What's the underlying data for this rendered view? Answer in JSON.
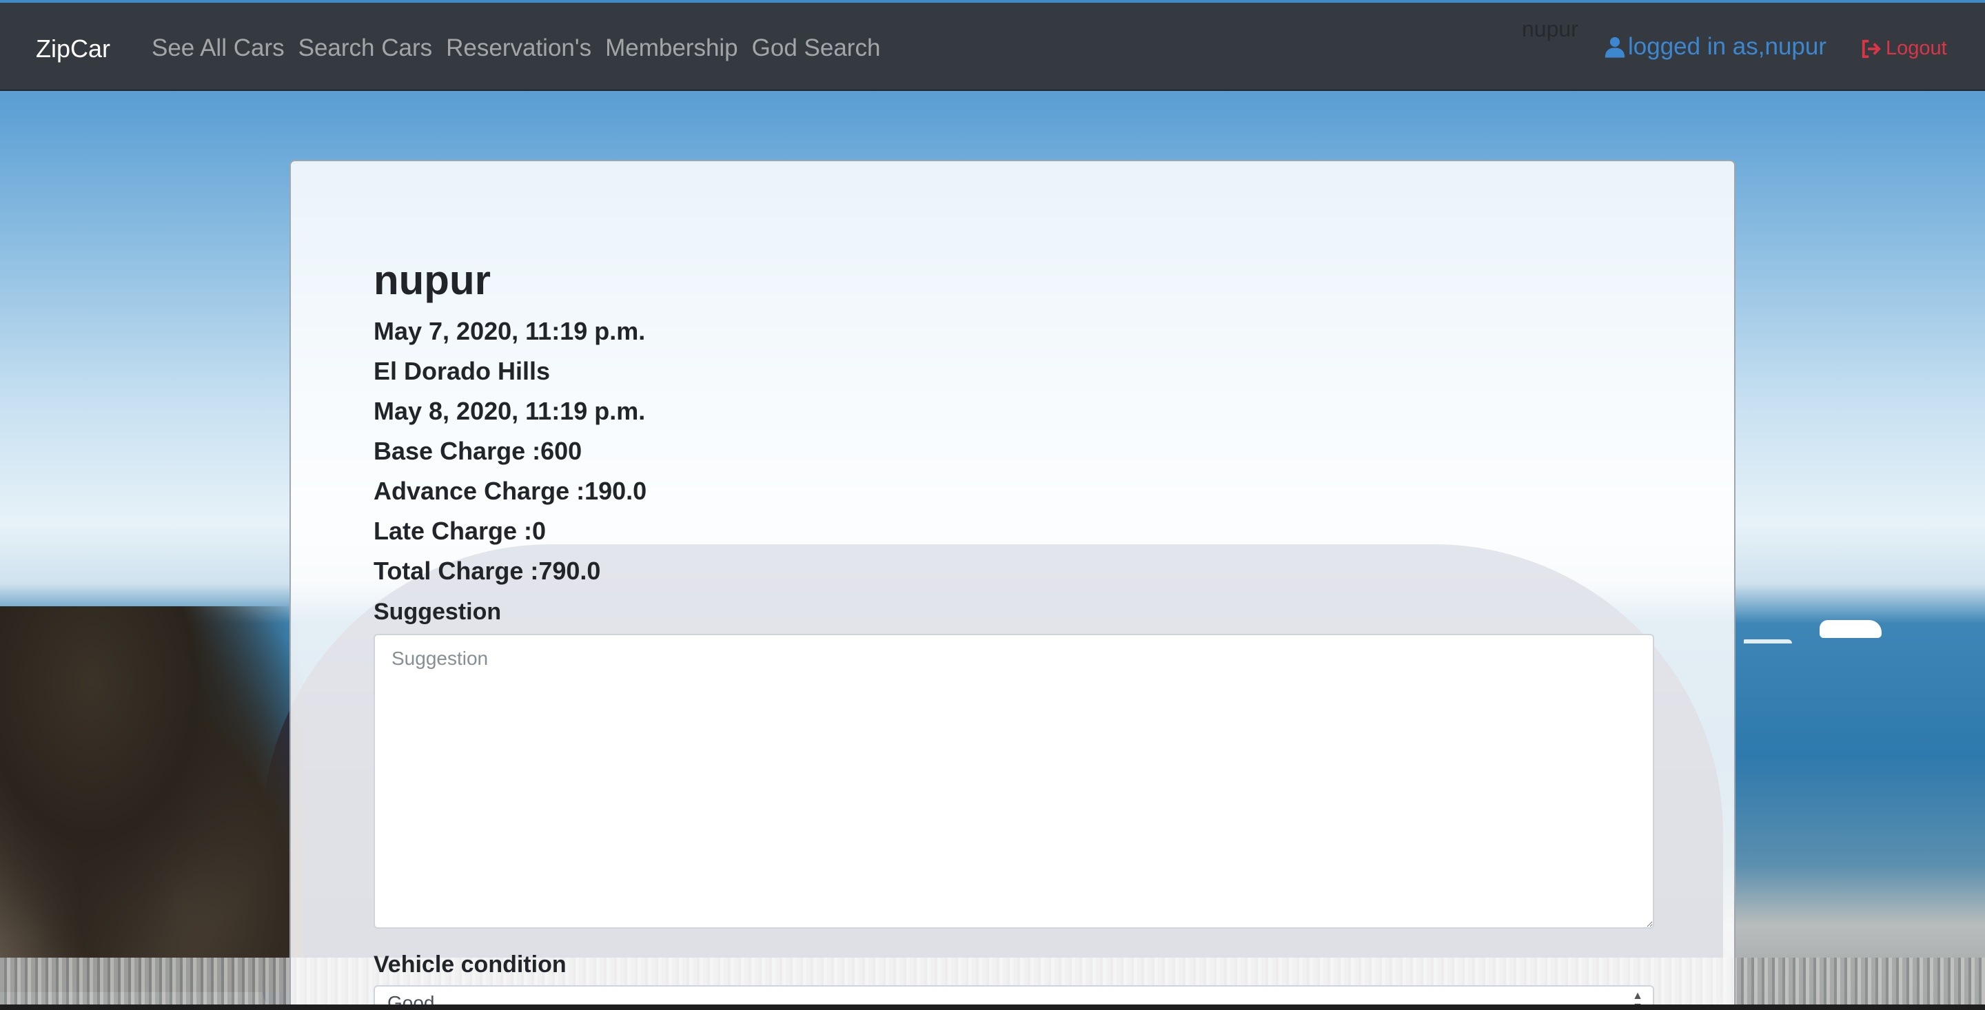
{
  "navbar": {
    "brand": "ZipCar",
    "links": [
      "See All Cars",
      "Search Cars",
      "Reservation's",
      "Membership",
      "God Search"
    ],
    "ghost_username": "nupur",
    "user_label": "logged in as,nupur",
    "logout_label": "Logout",
    "colors": {
      "background": "#343a40",
      "user": "#3d87d1",
      "logout": "#dc3545"
    }
  },
  "reservation": {
    "name": "nupur",
    "start_time": "May 7, 2020, 11:19 p.m.",
    "location": "El Dorado Hills",
    "end_time": "May 8, 2020, 11:19 p.m.",
    "base_charge": "Base Charge :600",
    "advance_charge": "Advance Charge :190.0",
    "late_charge": "Late Charge :0",
    "total_charge": "Total Charge :790.0"
  },
  "form": {
    "suggestion_label": "Suggestion",
    "suggestion_placeholder": "Suggestion",
    "suggestion_value": "",
    "condition_label": "Vehicle condition",
    "condition_selected": "Good"
  },
  "icons": {
    "user": "user-icon",
    "logout": "logout-icon"
  }
}
